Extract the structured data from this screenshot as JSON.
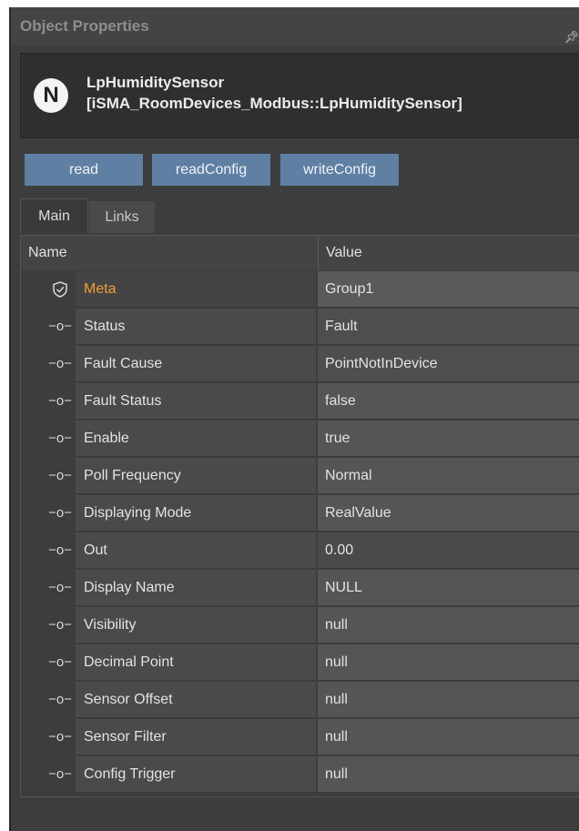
{
  "panel": {
    "title": "Object Properties"
  },
  "object": {
    "icon_letter": "N",
    "name": "LpHumiditySensor",
    "type": "[iSMA_RoomDevices_Modbus::LpHumiditySensor]"
  },
  "actions": {
    "read": "read",
    "readConfig": "readConfig",
    "writeConfig": "writeConfig"
  },
  "tabs": {
    "main": "Main",
    "links": "Links"
  },
  "grid": {
    "col_name": "Name",
    "col_value": "Value",
    "rows": [
      {
        "name": "Meta",
        "value": "Group1",
        "icon": "shield-icon"
      },
      {
        "name": "Status",
        "value": "Fault",
        "icon": "slot-icon"
      },
      {
        "name": "Fault Cause",
        "value": "PointNotInDevice",
        "icon": "slot-icon"
      },
      {
        "name": "Fault Status",
        "value": "false",
        "icon": "slot-icon"
      },
      {
        "name": "Enable",
        "value": "true",
        "icon": "slot-icon"
      },
      {
        "name": "Poll Frequency",
        "value": "Normal",
        "icon": "slot-icon"
      },
      {
        "name": "Displaying Mode",
        "value": "RealValue",
        "icon": "slot-icon"
      },
      {
        "name": "Out",
        "value": "0.00",
        "icon": "slot-icon"
      },
      {
        "name": "Display Name",
        "value": "NULL",
        "icon": "slot-icon"
      },
      {
        "name": "Visibility",
        "value": "null",
        "icon": "slot-icon"
      },
      {
        "name": "Decimal Point",
        "value": "null",
        "icon": "slot-icon"
      },
      {
        "name": "Sensor Offset",
        "value": "null",
        "icon": "slot-icon"
      },
      {
        "name": "Sensor Filter",
        "value": "null",
        "icon": "slot-icon"
      },
      {
        "name": "Config Trigger",
        "value": "null",
        "icon": "slot-icon"
      }
    ]
  },
  "colors": {
    "accent_button": "#5f7fa3",
    "meta_label": "#f0a030"
  }
}
